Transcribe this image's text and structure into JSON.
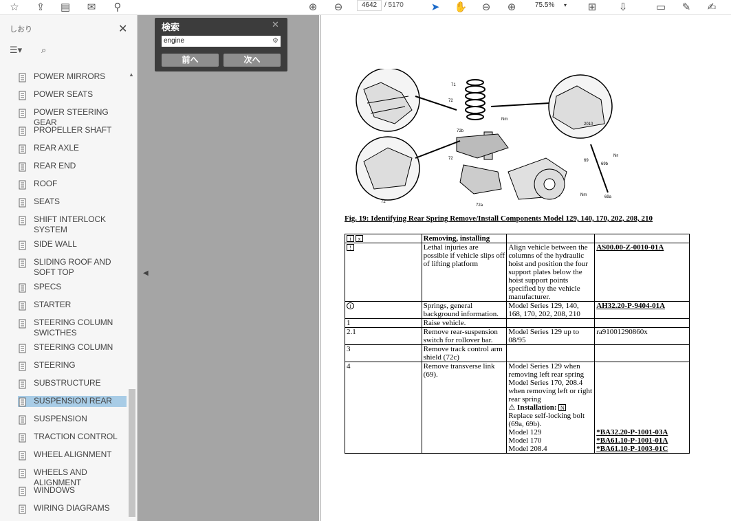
{
  "toolbar": {
    "page_current": "4642",
    "page_total": "/ 5170",
    "zoom": "75.5%",
    "icons_left": [
      "star-icon",
      "upload-icon",
      "print-icon",
      "mail-icon",
      "search-zoom-icon"
    ],
    "icons_nav": [
      "prev-page-icon",
      "next-page-icon"
    ],
    "icons_right": [
      "select-cursor-icon",
      "hand-icon",
      "zoom-out-icon",
      "zoom-in-icon"
    ],
    "icons_far": [
      "fit-page-icon",
      "scroll-icon",
      "comment-icon",
      "highlight-icon",
      "sign-icon"
    ]
  },
  "sidebar": {
    "title": "しおり",
    "items": [
      {
        "label": "POWER MIRRORS"
      },
      {
        "label": "POWER SEATS"
      },
      {
        "label": "POWER STEERING GEAR"
      },
      {
        "label": "PROPELLER SHAFT"
      },
      {
        "label": "REAR AXLE"
      },
      {
        "label": "REAR END"
      },
      {
        "label": "ROOF"
      },
      {
        "label": "SEATS"
      },
      {
        "label": "SHIFT INTERLOCK SYSTEM"
      },
      {
        "label": "SIDE WALL"
      },
      {
        "label": "SLIDING ROOF AND SOFT TOP"
      },
      {
        "label": "SPECS"
      },
      {
        "label": "STARTER"
      },
      {
        "label": "STEERING COLUMN SWICTHES"
      },
      {
        "label": "STEERING COLUMN"
      },
      {
        "label": "STEERING"
      },
      {
        "label": "SUBSTRUCTURE"
      },
      {
        "label": "SUSPENSION REAR"
      },
      {
        "label": "SUSPENSION"
      },
      {
        "label": "TRACTION CONTROL"
      },
      {
        "label": "WHEEL ALIGNMENT"
      },
      {
        "label": "WHEELS AND ALIGNMENT"
      },
      {
        "label": "WINDOWS"
      },
      {
        "label": "WIRING DIAGRAMS"
      }
    ],
    "selected": "SUSPENSION REAR"
  },
  "search": {
    "title": "検索",
    "query": "engine",
    "prev_label": "前へ",
    "next_label": "次へ"
  },
  "document": {
    "figure_labels": [
      "71",
      "72",
      "72b",
      "72",
      "72",
      "72a",
      "69",
      "69b",
      "69a",
      "2010",
      "Nm",
      "Nm",
      "Nm"
    ],
    "caption": "Fig. 19: Identifying Rear Spring Remove/Install Components   Model 129, 140, 170, 202, 208, 210",
    "rows": [
      {
        "c1": "",
        "c2": "Removing, installing",
        "c3": "",
        "c4": ""
      },
      {
        "c1": "",
        "c2": "Lethal injuries are possible if vehicle slips off of lifting platform",
        "c3": "Align vehicle between the columns of the hydraulic hoist and position the four support plates below the hoist support points specified by the vehicle manufacturer.",
        "c4": "AS00.00-Z-0010-01A"
      },
      {
        "c1": "",
        "c2": "Springs, general background information.",
        "c3": "Model Series 129, 140, 168, 170, 202, 208, 210",
        "c4": "AH32.20-P-9404-01A"
      },
      {
        "c1": "1",
        "c2": "Raise vehicle.",
        "c3": "",
        "c4": ""
      },
      {
        "c1": "2.1",
        "c2": "Remove rear-suspension switch for rollover bar.",
        "c3": "Model Series 129 up to 08/95",
        "c4": "ra91001290860x"
      },
      {
        "c1": "3",
        "c2": "Remove track control arm shield (72c)",
        "c3": "",
        "c4": ""
      },
      {
        "c1": "4",
        "c2": "Remove transverse link (69).",
        "c3": "",
        "c4": ""
      }
    ],
    "row4_c3_lines": [
      "Model Series 129 when removing left rear spring",
      "Model Series 170, 208.4 when removing left or right rear spring",
      "Installation:",
      "Replace self-locking bolt (69a, 69b).",
      "Model 129",
      "Model 170",
      "Model 208.4"
    ],
    "row4_c4_lines": [
      "*BA32.20-P-1001-03A",
      "*BA61.10-P-1001-01A",
      "*BA61.10-P-1003-01C"
    ]
  }
}
